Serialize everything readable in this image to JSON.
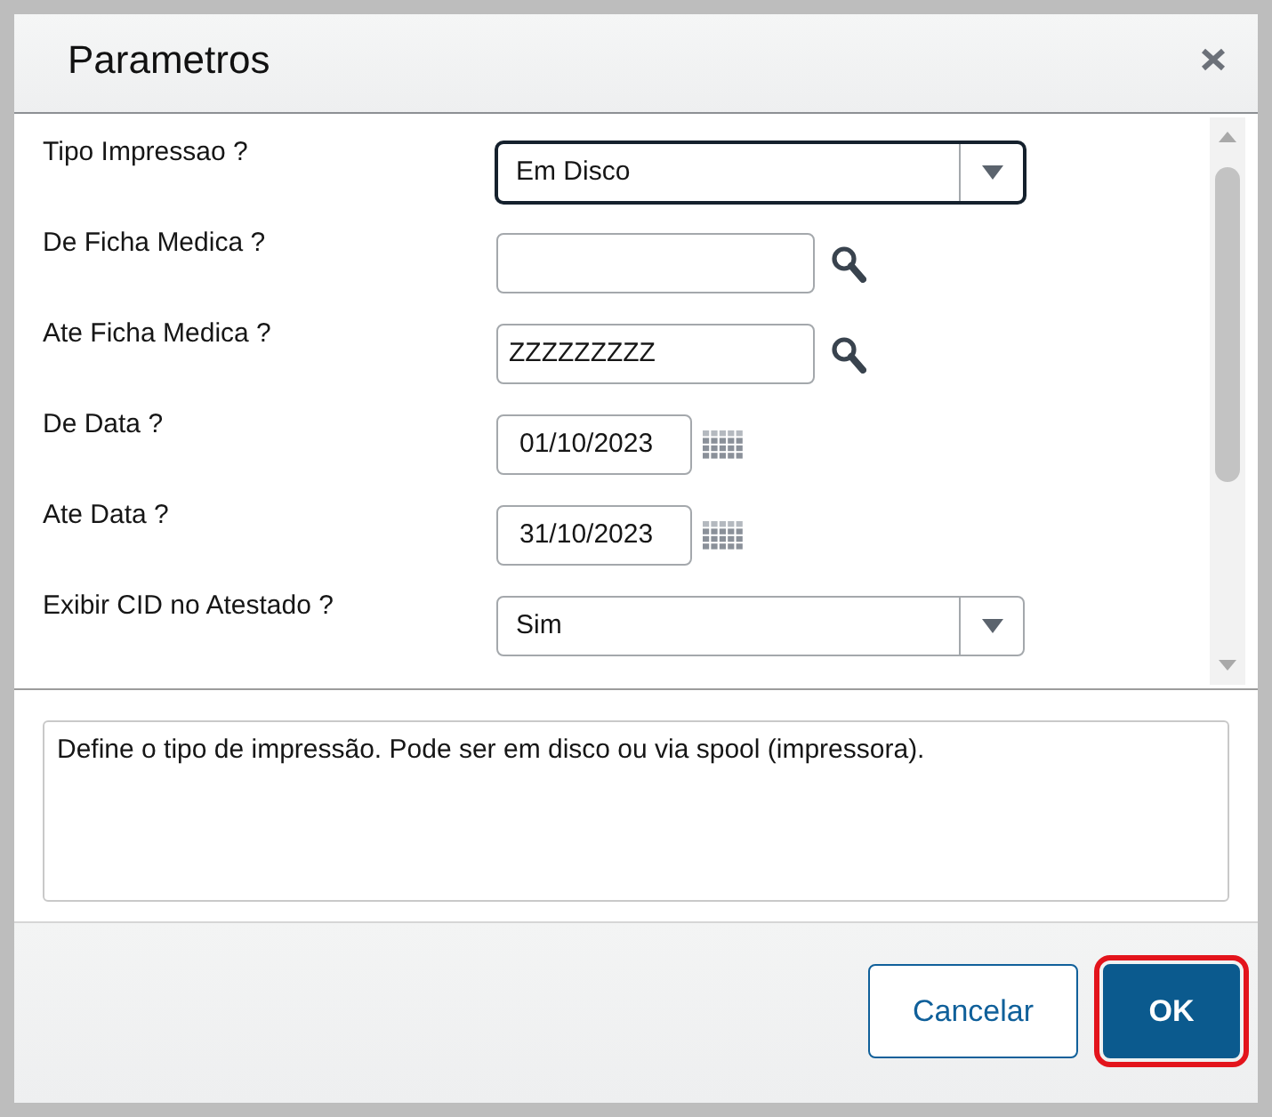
{
  "dialog": {
    "title": "Parametros"
  },
  "parameters": [
    {
      "label": "Tipo Impressao ?",
      "kind": "select",
      "value": "Em Disco",
      "focused": true
    },
    {
      "label": "De Ficha Medica ?",
      "kind": "lookup",
      "focused": false
    },
    {
      "label": "Ate Ficha Medica ?",
      "kind": "lookup",
      "value": "ZZZZZZZZZ",
      "focused": false
    },
    {
      "label": "De Data ?",
      "kind": "date",
      "value": "01/10/2023",
      "focused": false
    },
    {
      "label": "Ate Data ?",
      "kind": "date",
      "value": "31/10/2023",
      "focused": false
    },
    {
      "label": "Exibir CID no Atestado ?",
      "kind": "select",
      "value": "Sim",
      "focused": false
    }
  ],
  "help_text": "Define o tipo de impressão. Pode ser em disco ou via spool (impressora).",
  "buttons": [
    {
      "label": "Cancelar",
      "kind": "secondary",
      "focused": false
    },
    {
      "label": "OK",
      "kind": "primary",
      "focused": true
    }
  ]
}
